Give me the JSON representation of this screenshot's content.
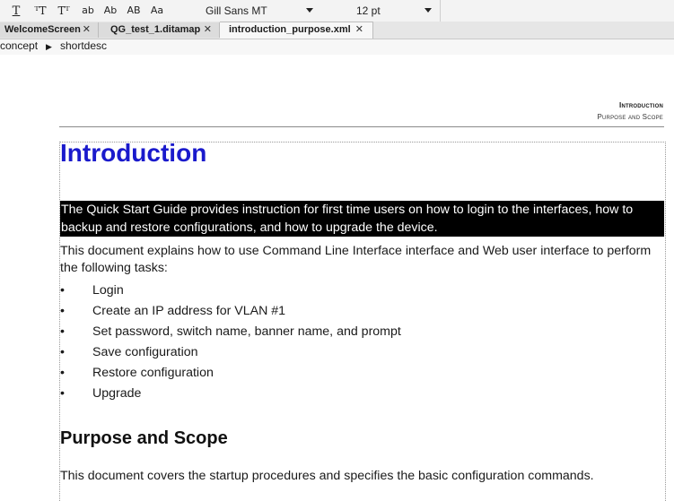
{
  "toolbar": {
    "buttons": [
      {
        "name": "underline",
        "label": "T"
      },
      {
        "name": "superscript",
        "label": "ᵀT"
      },
      {
        "name": "subscript",
        "label": "Tᵀ"
      },
      {
        "name": "lowercase",
        "label": "ab"
      },
      {
        "name": "titlecase",
        "label": "Ab"
      },
      {
        "name": "uppercase",
        "label": "AB"
      },
      {
        "name": "sentencecase",
        "label": "Aa"
      }
    ],
    "font_family": "Gill Sans MT",
    "font_size": "12 pt"
  },
  "tabs": [
    {
      "label": "WelcomeScreen",
      "close": "✕",
      "active": false
    },
    {
      "label": "QG_test_1.ditamap",
      "close": "✕",
      "active": false
    },
    {
      "label": "introduction_purpose.xml",
      "close": "✕",
      "active": true
    }
  ],
  "breadcrumb": {
    "items": [
      "concept",
      "shortdesc"
    ],
    "separator": "▶"
  },
  "document": {
    "running_header": {
      "line1": "Introduction",
      "line2": "Purpose and Scope"
    },
    "title": "Introduction",
    "shortdesc": "The Quick Start Guide provides instruction for first time users on how to login to the interfaces, how to backup and restore configurations, and how to upgrade the device.",
    "intro_paragraph": "This document explains how to use Command Line Interface interface and Web user interface to perform the following tasks:",
    "bullet_char": "•",
    "tasks": [
      "Login",
      "Create an IP address for VLAN #1",
      "Set password, switch name, banner name, and prompt",
      "Save configuration",
      "Restore configuration",
      "Upgrade"
    ],
    "section_title": "Purpose and Scope",
    "section_paragraph": "This document covers the startup procedures and specifies the basic configuration commands."
  },
  "colors": {
    "title": "#1a1acc",
    "shortdesc_bg": "#000000",
    "shortdesc_text": "#ffffff"
  }
}
